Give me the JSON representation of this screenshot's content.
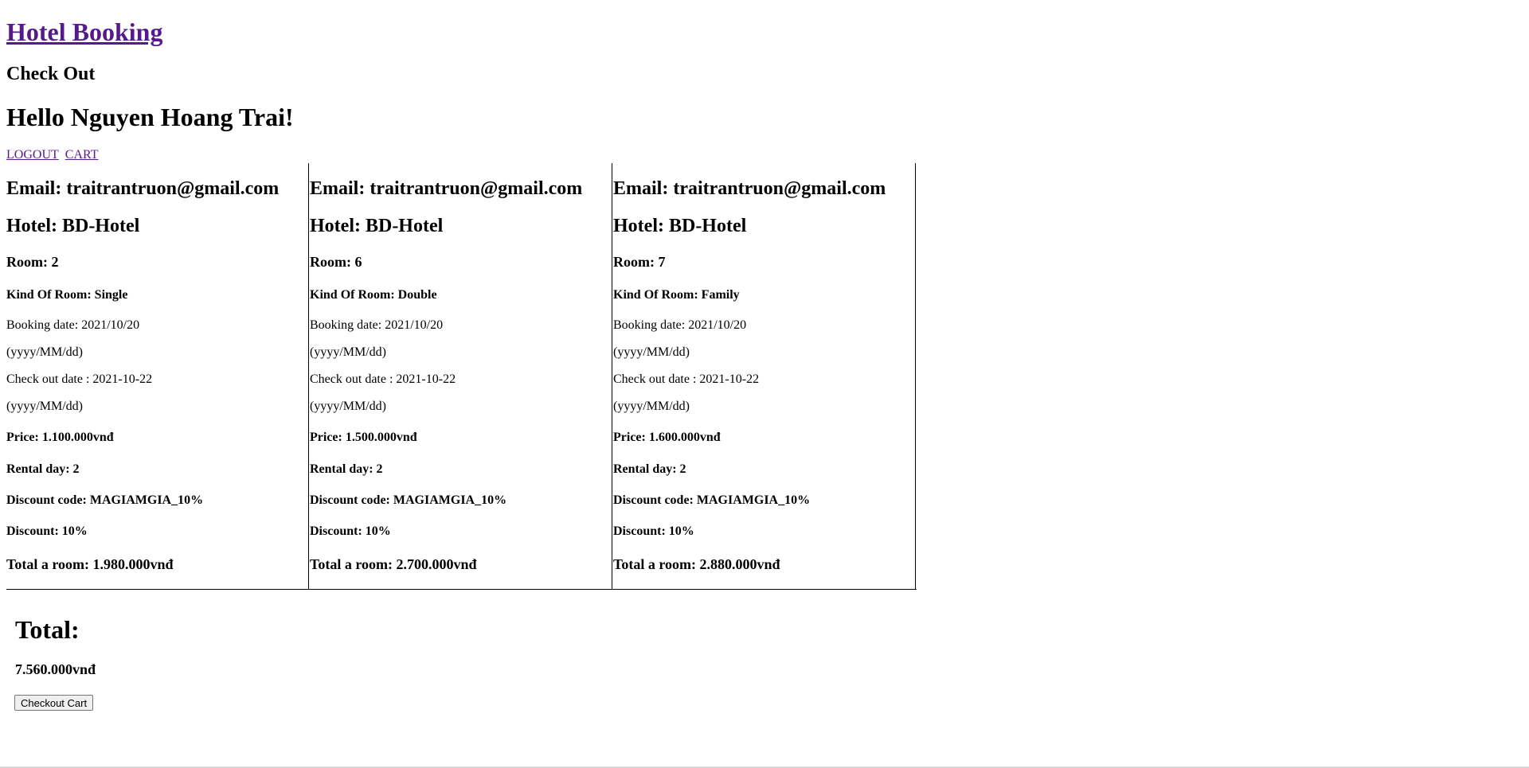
{
  "header": {
    "title": "Hotel Booking",
    "subtitle": "Check Out",
    "greeting": "Hello Nguyen Hoang Trai!"
  },
  "nav": {
    "logout": "LOGOUT",
    "cart": "CART"
  },
  "bookings": [
    {
      "email": "Email: traitrantruon@gmail.com",
      "hotel": "Hotel: BD-Hotel",
      "room": "Room: 2",
      "kind": "Kind Of Room: Single",
      "booking_date": "Booking date: 2021/10/20",
      "date_format_1": "(yyyy/MM/dd)",
      "checkout_date": "Check out date : 2021-10-22",
      "date_format_2": "(yyyy/MM/dd)",
      "price": "Price: 1.100.000vnđ",
      "rental_day": "Rental day: 2",
      "discount_code": "Discount code: MAGIAMGIA_10%",
      "discount": "Discount: 10%",
      "total": "Total a room: 1.980.000vnđ"
    },
    {
      "email": "Email: traitrantruon@gmail.com",
      "hotel": "Hotel: BD-Hotel",
      "room": "Room: 6",
      "kind": "Kind Of Room: Double",
      "booking_date": "Booking date: 2021/10/20",
      "date_format_1": "(yyyy/MM/dd)",
      "checkout_date": "Check out date : 2021-10-22",
      "date_format_2": "(yyyy/MM/dd)",
      "price": "Price: 1.500.000vnđ",
      "rental_day": "Rental day: 2",
      "discount_code": "Discount code: MAGIAMGIA_10%",
      "discount": "Discount: 10%",
      "total": "Total a room: 2.700.000vnđ"
    },
    {
      "email": "Email: traitrantruon@gmail.com",
      "hotel": "Hotel: BD-Hotel",
      "room": "Room: 7",
      "kind": "Kind Of Room: Family",
      "booking_date": "Booking date: 2021/10/20",
      "date_format_1": "(yyyy/MM/dd)",
      "checkout_date": "Check out date : 2021-10-22",
      "date_format_2": "(yyyy/MM/dd)",
      "price": "Price: 1.600.000vnđ",
      "rental_day": "Rental day: 2",
      "discount_code": "Discount code: MAGIAMGIA_10%",
      "discount": "Discount: 10%",
      "total": "Total a room: 2.880.000vnđ"
    }
  ],
  "summary": {
    "total_label": "Total:",
    "total_value": "7.560.000vnđ",
    "checkout_button": "Checkout Cart"
  },
  "colors": {
    "link_visited": "#551a8b",
    "border": "#000000"
  }
}
